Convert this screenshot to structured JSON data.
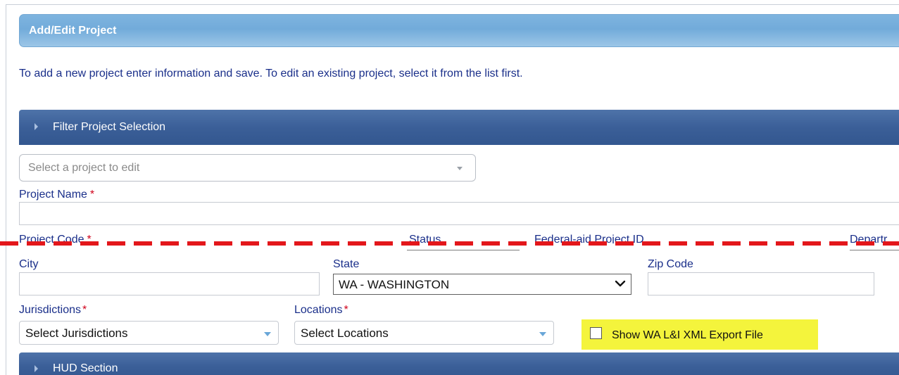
{
  "panel": {
    "title": "Add/Edit Project",
    "instructions": "To add a new project enter information and save. To edit an existing project, select it from the list first."
  },
  "filter_section": {
    "label": "Filter Project Selection"
  },
  "project_select": {
    "placeholder": "Select a project to edit"
  },
  "fields": {
    "project_name": {
      "label": "Project Name",
      "required": "*"
    },
    "project_code": {
      "label": "Project Code",
      "required": "*"
    },
    "status": {
      "label": "Status"
    },
    "federal_aid_id": {
      "label": "Federal-aid Project ID"
    },
    "department": {
      "label": "Departr"
    },
    "city": {
      "label": "City"
    },
    "state": {
      "label": "State",
      "value": "WA - WASHINGTON"
    },
    "zip": {
      "label": "Zip Code"
    },
    "jurisdictions": {
      "label": "Jurisdictions",
      "required": "*",
      "value": "Select Jurisdictions"
    },
    "locations": {
      "label": "Locations",
      "required": "*",
      "value": "Select Locations"
    }
  },
  "export_checkbox": {
    "label": "Show WA L&I XML Export File",
    "checked": false
  },
  "hud_section": {
    "label": "HUD Section"
  },
  "colors": {
    "label_text": "#1a2f8a",
    "required_mark": "#d0021b",
    "section_bar": "#3b5f98",
    "title_bar": "#7eb4df",
    "highlight": "#f4f43c",
    "annotation_dash": "#e3171b"
  },
  "icons": {
    "section_toggle": "triangle-right-icon",
    "dropdown": "caret-down-icon",
    "state_dropdown": "chevron-down-icon"
  }
}
